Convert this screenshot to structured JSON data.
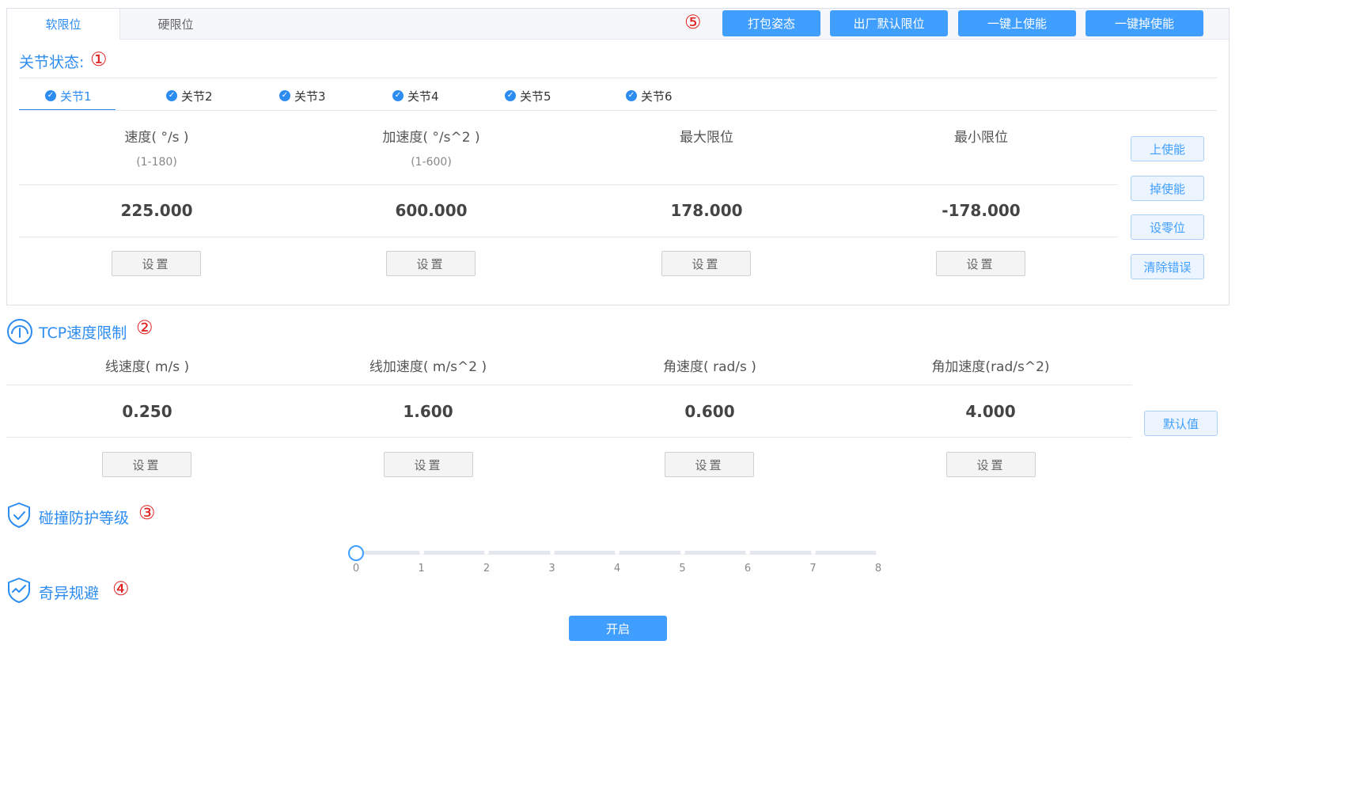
{
  "tabs": [
    {
      "label": "软限位",
      "active": true
    },
    {
      "label": "硬限位",
      "active": false
    }
  ],
  "markers": {
    "m1": "①",
    "m2": "②",
    "m3": "③",
    "m4": "④",
    "m5": "⑤"
  },
  "top_buttons": [
    "打包姿态",
    "出厂默认限位",
    "一键上使能",
    "一键掉使能"
  ],
  "joint_section": {
    "title": "关节状态:",
    "joints": [
      "关节1",
      "关节2",
      "关节3",
      "关节4",
      "关节5",
      "关节6"
    ],
    "columns": [
      {
        "header": "速度( °/s )",
        "range": "(1-180)",
        "value": "225.000",
        "button": "设置"
      },
      {
        "header": "加速度( °/s^2 )",
        "range": "(1-600)",
        "value": "600.000",
        "button": "设置"
      },
      {
        "header": "最大限位",
        "range": "",
        "value": "178.000",
        "button": "设置"
      },
      {
        "header": "最小限位",
        "range": "",
        "value": "-178.000",
        "button": "设置"
      }
    ],
    "side_buttons": [
      "上使能",
      "掉使能",
      "设零位",
      "清除错误"
    ]
  },
  "tcp_section": {
    "title": "TCP速度限制",
    "columns": [
      {
        "header": "线速度( m/s )",
        "value": "0.250",
        "button": "设置"
      },
      {
        "header": "线加速度( m/s^2 )",
        "value": "1.600",
        "button": "设置"
      },
      {
        "header": "角速度( rad/s )",
        "value": "0.600",
        "button": "设置"
      },
      {
        "header": "角加速度(rad/s^2)",
        "value": "4.000",
        "button": "设置"
      }
    ],
    "default_button": "默认值"
  },
  "collision_section": {
    "title": "碰撞防护等级",
    "slider_min": 0,
    "slider_max": 8,
    "slider_value": 0,
    "ticks": [
      "0",
      "1",
      "2",
      "3",
      "4",
      "5",
      "6",
      "7",
      "8"
    ]
  },
  "singularity_section": {
    "title": "奇异规避",
    "button": "开启"
  },
  "colors": {
    "accent": "#409eff",
    "title_blue": "#2d8cf0",
    "marker_red": "#e02020"
  },
  "icons": {
    "tcp": "speedometer-icon",
    "collision": "shield-check-icon",
    "singularity": "shield-wave-icon",
    "joint_check": "check-circle-icon"
  }
}
